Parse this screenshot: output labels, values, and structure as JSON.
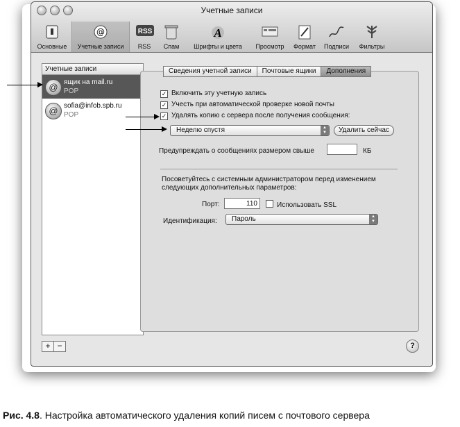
{
  "window": {
    "title": "Учетные записи"
  },
  "toolbar": {
    "items": [
      {
        "label": "Основные",
        "icon": "switch-icon"
      },
      {
        "label": "Учетные записи",
        "icon": "at-icon"
      },
      {
        "label": "RSS",
        "icon": "rss-icon"
      },
      {
        "label": "Спам",
        "icon": "trash-icon"
      },
      {
        "label": "Шрифты и цвета",
        "icon": "font-icon"
      },
      {
        "label": "Просмотр",
        "icon": "view-icon"
      },
      {
        "label": "Формат",
        "icon": "pencil-icon"
      },
      {
        "label": "Подписи",
        "icon": "signature-icon"
      },
      {
        "label": "Фильтры",
        "icon": "filter-icon"
      }
    ],
    "selected": "Учетные записи"
  },
  "sidebar": {
    "header": "Учетные записи",
    "accounts": [
      {
        "name": "ящик на mail.ru",
        "type": "POP",
        "selected": true
      },
      {
        "name": "sofia@infob.spb.ru",
        "type": "POP",
        "selected": false
      }
    ],
    "add_label": "+",
    "remove_label": "−"
  },
  "tabs": [
    {
      "label": "Сведения учетной записи"
    },
    {
      "label": "Почтовые ящики"
    },
    {
      "label": "Дополнения",
      "selected": true
    }
  ],
  "options": {
    "enable_account": {
      "label": "Включить эту учетную запись",
      "checked": true
    },
    "include_auto_check": {
      "label": "Учесть при автоматической проверке новой почты",
      "checked": true
    },
    "delete_copy": {
      "label": "Удалять копию с сервера после получения сообщения:",
      "checked": true
    },
    "delete_period": "Неделю спустя",
    "delete_now_label": "Удалить сейчас",
    "warn_label": "Предупреждать о сообщениях размером свыше",
    "warn_value": "",
    "warn_unit": "КБ",
    "admin_note_line1": "Посоветуйтесь с системным администратором перед изменением",
    "admin_note_line2": "следующих дополнительных параметров:",
    "port_label": "Порт:",
    "port_value": "110",
    "ssl": {
      "label": "Использовать SSL",
      "checked": false
    },
    "auth_label": "Идентификация:",
    "auth_value": "Пароль"
  },
  "help_label": "?",
  "caption": {
    "prefix": "Рис. 4.8",
    "text": ". Настройка автоматического удаления копий писем с почтового сервера"
  }
}
